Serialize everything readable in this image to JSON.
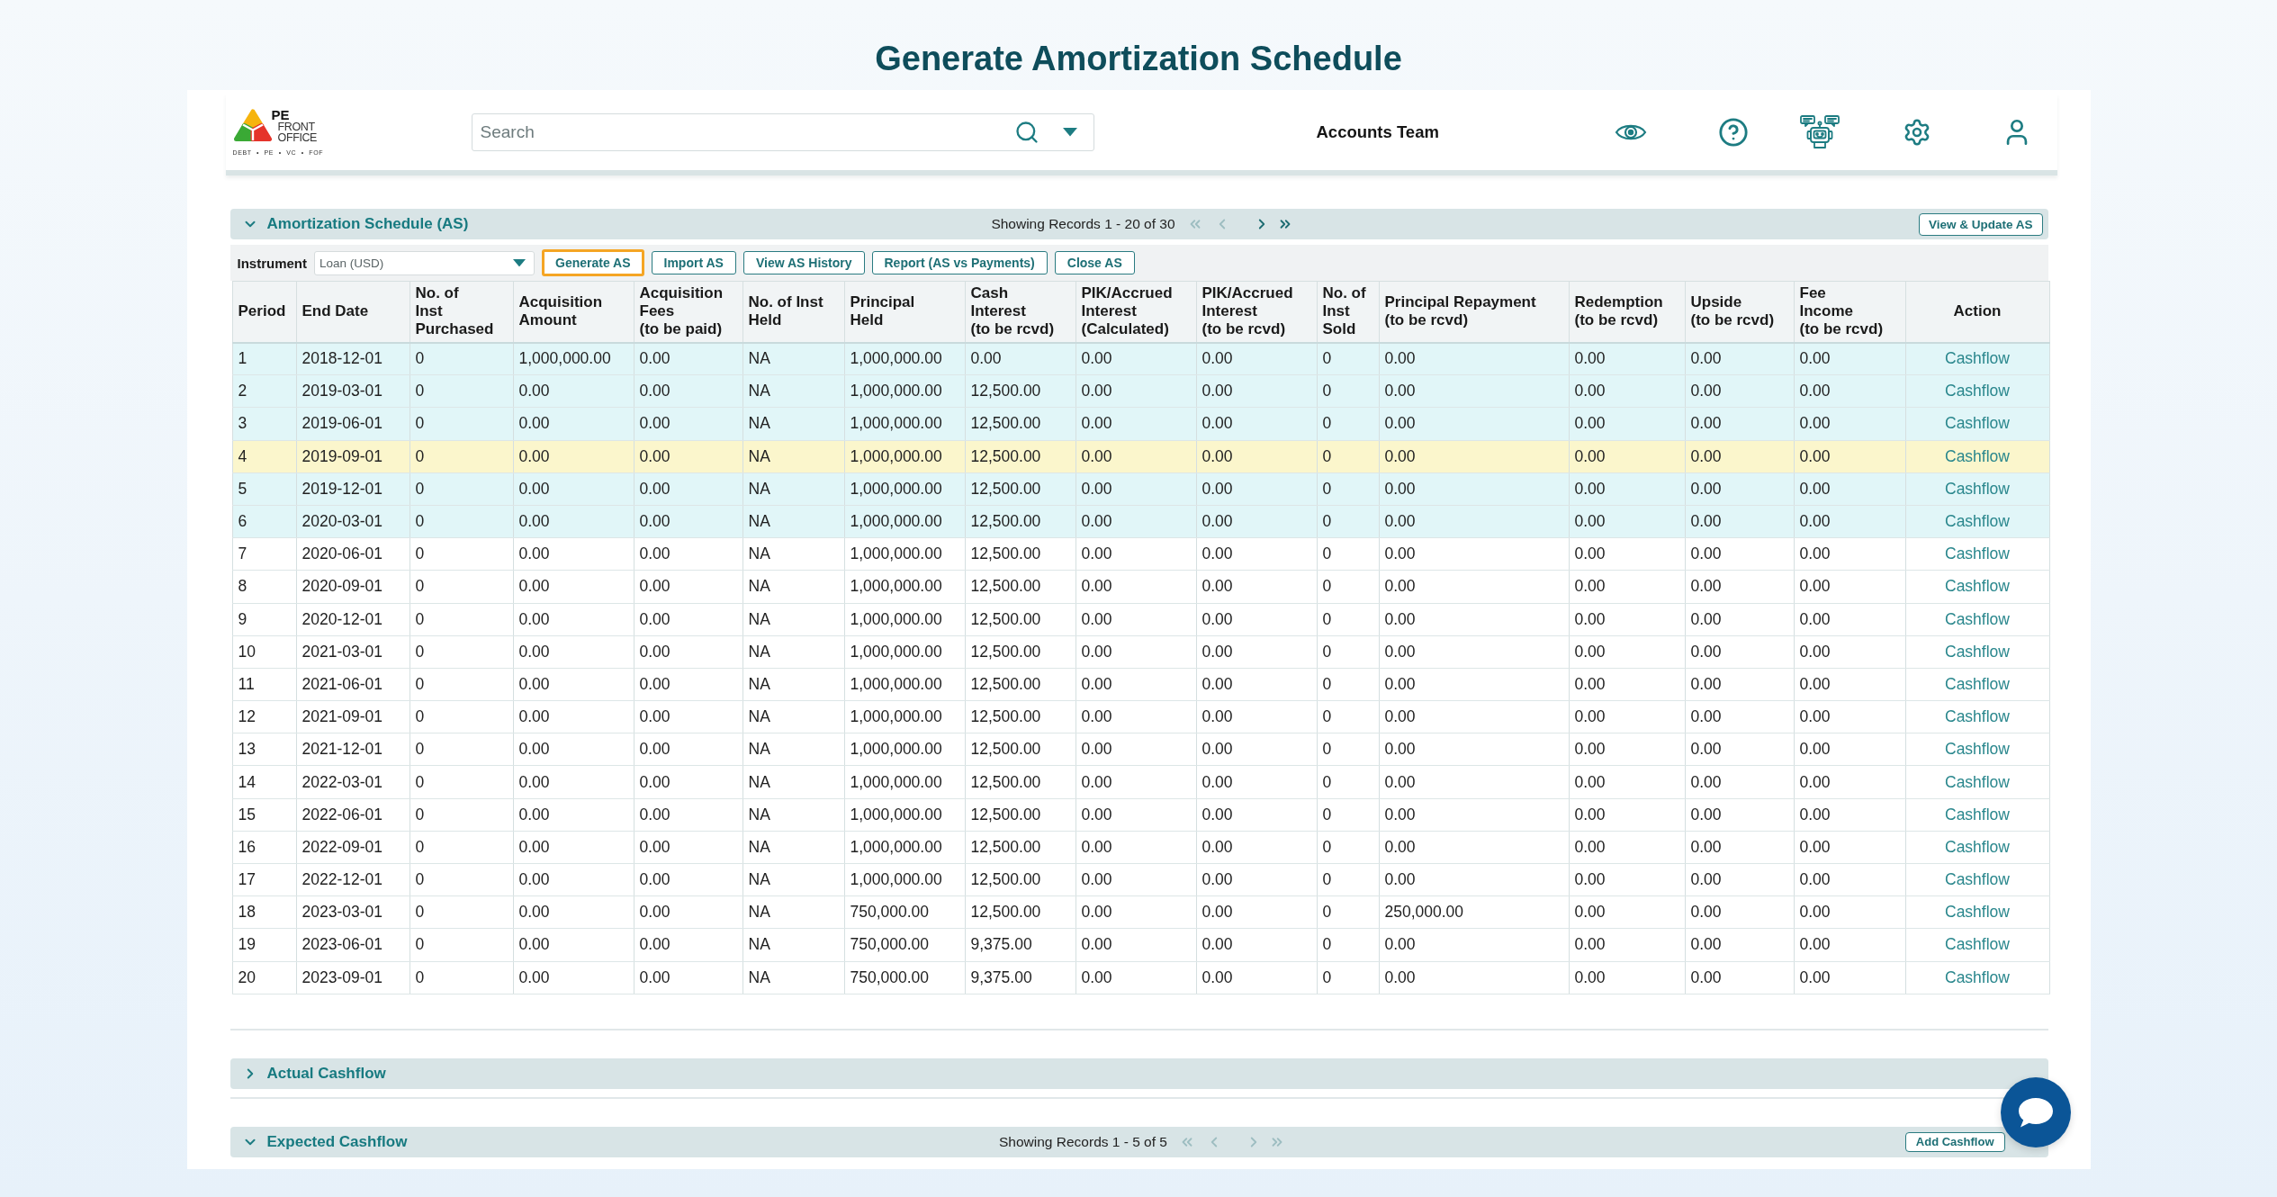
{
  "page_title": "Generate Amortization Schedule",
  "header": {
    "logo": {
      "initials": "PE",
      "name_lines": [
        "FRONT",
        "OFFICE"
      ],
      "tagline": "DEBT • PE • VC • FOF"
    },
    "search": {
      "placeholder": "Search"
    },
    "team": "Accounts Team"
  },
  "amortization_schedule": {
    "title": "Amortization Schedule (AS)",
    "expanded": true,
    "records": "Showing Records 1 - 20 of 30",
    "pager": [
      {
        "kind": "first",
        "disabled": true
      },
      {
        "kind": "previous",
        "disabled": true
      },
      {
        "kind": "next",
        "disabled": false
      },
      {
        "kind": "last",
        "disabled": false
      }
    ],
    "action_button": "View & Update AS",
    "instrument": {
      "label": "Instrument",
      "value": "Loan (USD)"
    },
    "buttons": [
      {
        "label": "Generate AS",
        "selected": true
      },
      {
        "label": "Import AS",
        "selected": false
      },
      {
        "label": "View AS History",
        "selected": false
      },
      {
        "label": "Report (AS vs Payments)",
        "selected": false
      },
      {
        "label": "Close AS",
        "selected": false
      }
    ],
    "table": {
      "columns": [
        "Period",
        "End Date",
        "No. of\nInst\nPurchased",
        "Acquisition\nAmount",
        "Acquisition\nFees\n(to be paid)",
        "No. of Inst\nHeld",
        "Principal\nHeld",
        "Cash\nInterest\n(to be rcvd)",
        "PIK/Accrued\nInterest\n(Calculated)",
        "PIK/Accrued\nInterest\n(to be rcvd)",
        "No. of\nInst\nSold",
        "Principal Repayment\n(to be rcvd)",
        "Redemption\n(to be rcvd)",
        "Upside\n(to be rcvd)",
        "Fee\nIncome\n(to be rcvd)",
        "Action"
      ],
      "rows": [
        {
          "cells": [
            "1",
            "2018-12-01",
            "0",
            "1,000,000.00",
            "0.00",
            "NA",
            "1,000,000.00",
            "0.00",
            "0.00",
            "0.00",
            "0",
            "0.00",
            "0.00",
            "0.00",
            "0.00"
          ],
          "action": "Cashflow",
          "tinted": true,
          "highlighted": false
        },
        {
          "cells": [
            "2",
            "2019-03-01",
            "0",
            "0.00",
            "0.00",
            "NA",
            "1,000,000.00",
            "12,500.00",
            "0.00",
            "0.00",
            "0",
            "0.00",
            "0.00",
            "0.00",
            "0.00"
          ],
          "action": "Cashflow",
          "tinted": true,
          "highlighted": false
        },
        {
          "cells": [
            "3",
            "2019-06-01",
            "0",
            "0.00",
            "0.00",
            "NA",
            "1,000,000.00",
            "12,500.00",
            "0.00",
            "0.00",
            "0",
            "0.00",
            "0.00",
            "0.00",
            "0.00"
          ],
          "action": "Cashflow",
          "tinted": true,
          "highlighted": false
        },
        {
          "cells": [
            "4",
            "2019-09-01",
            "0",
            "0.00",
            "0.00",
            "NA",
            "1,000,000.00",
            "12,500.00",
            "0.00",
            "0.00",
            "0",
            "0.00",
            "0.00",
            "0.00",
            "0.00"
          ],
          "action": "Cashflow",
          "tinted": false,
          "highlighted": true
        },
        {
          "cells": [
            "5",
            "2019-12-01",
            "0",
            "0.00",
            "0.00",
            "NA",
            "1,000,000.00",
            "12,500.00",
            "0.00",
            "0.00",
            "0",
            "0.00",
            "0.00",
            "0.00",
            "0.00"
          ],
          "action": "Cashflow",
          "tinted": true,
          "highlighted": false
        },
        {
          "cells": [
            "6",
            "2020-03-01",
            "0",
            "0.00",
            "0.00",
            "NA",
            "1,000,000.00",
            "12,500.00",
            "0.00",
            "0.00",
            "0",
            "0.00",
            "0.00",
            "0.00",
            "0.00"
          ],
          "action": "Cashflow",
          "tinted": true,
          "highlighted": false
        },
        {
          "cells": [
            "7",
            "2020-06-01",
            "0",
            "0.00",
            "0.00",
            "NA",
            "1,000,000.00",
            "12,500.00",
            "0.00",
            "0.00",
            "0",
            "0.00",
            "0.00",
            "0.00",
            "0.00"
          ],
          "action": "Cashflow",
          "tinted": false,
          "highlighted": false
        },
        {
          "cells": [
            "8",
            "2020-09-01",
            "0",
            "0.00",
            "0.00",
            "NA",
            "1,000,000.00",
            "12,500.00",
            "0.00",
            "0.00",
            "0",
            "0.00",
            "0.00",
            "0.00",
            "0.00"
          ],
          "action": "Cashflow",
          "tinted": false,
          "highlighted": false
        },
        {
          "cells": [
            "9",
            "2020-12-01",
            "0",
            "0.00",
            "0.00",
            "NA",
            "1,000,000.00",
            "12,500.00",
            "0.00",
            "0.00",
            "0",
            "0.00",
            "0.00",
            "0.00",
            "0.00"
          ],
          "action": "Cashflow",
          "tinted": false,
          "highlighted": false
        },
        {
          "cells": [
            "10",
            "2021-03-01",
            "0",
            "0.00",
            "0.00",
            "NA",
            "1,000,000.00",
            "12,500.00",
            "0.00",
            "0.00",
            "0",
            "0.00",
            "0.00",
            "0.00",
            "0.00"
          ],
          "action": "Cashflow",
          "tinted": false,
          "highlighted": false
        },
        {
          "cells": [
            "11",
            "2021-06-01",
            "0",
            "0.00",
            "0.00",
            "NA",
            "1,000,000.00",
            "12,500.00",
            "0.00",
            "0.00",
            "0",
            "0.00",
            "0.00",
            "0.00",
            "0.00"
          ],
          "action": "Cashflow",
          "tinted": false,
          "highlighted": false
        },
        {
          "cells": [
            "12",
            "2021-09-01",
            "0",
            "0.00",
            "0.00",
            "NA",
            "1,000,000.00",
            "12,500.00",
            "0.00",
            "0.00",
            "0",
            "0.00",
            "0.00",
            "0.00",
            "0.00"
          ],
          "action": "Cashflow",
          "tinted": false,
          "highlighted": false
        },
        {
          "cells": [
            "13",
            "2021-12-01",
            "0",
            "0.00",
            "0.00",
            "NA",
            "1,000,000.00",
            "12,500.00",
            "0.00",
            "0.00",
            "0",
            "0.00",
            "0.00",
            "0.00",
            "0.00"
          ],
          "action": "Cashflow",
          "tinted": false,
          "highlighted": false
        },
        {
          "cells": [
            "14",
            "2022-03-01",
            "0",
            "0.00",
            "0.00",
            "NA",
            "1,000,000.00",
            "12,500.00",
            "0.00",
            "0.00",
            "0",
            "0.00",
            "0.00",
            "0.00",
            "0.00"
          ],
          "action": "Cashflow",
          "tinted": false,
          "highlighted": false
        },
        {
          "cells": [
            "15",
            "2022-06-01",
            "0",
            "0.00",
            "0.00",
            "NA",
            "1,000,000.00",
            "12,500.00",
            "0.00",
            "0.00",
            "0",
            "0.00",
            "0.00",
            "0.00",
            "0.00"
          ],
          "action": "Cashflow",
          "tinted": false,
          "highlighted": false
        },
        {
          "cells": [
            "16",
            "2022-09-01",
            "0",
            "0.00",
            "0.00",
            "NA",
            "1,000,000.00",
            "12,500.00",
            "0.00",
            "0.00",
            "0",
            "0.00",
            "0.00",
            "0.00",
            "0.00"
          ],
          "action": "Cashflow",
          "tinted": false,
          "highlighted": false
        },
        {
          "cells": [
            "17",
            "2022-12-01",
            "0",
            "0.00",
            "0.00",
            "NA",
            "1,000,000.00",
            "12,500.00",
            "0.00",
            "0.00",
            "0",
            "0.00",
            "0.00",
            "0.00",
            "0.00"
          ],
          "action": "Cashflow",
          "tinted": false,
          "highlighted": false
        },
        {
          "cells": [
            "18",
            "2023-03-01",
            "0",
            "0.00",
            "0.00",
            "NA",
            "750,000.00",
            "12,500.00",
            "0.00",
            "0.00",
            "0",
            "250,000.00",
            "0.00",
            "0.00",
            "0.00"
          ],
          "action": "Cashflow",
          "tinted": false,
          "highlighted": false
        },
        {
          "cells": [
            "19",
            "2023-06-01",
            "0",
            "0.00",
            "0.00",
            "NA",
            "750,000.00",
            "9,375.00",
            "0.00",
            "0.00",
            "0",
            "0.00",
            "0.00",
            "0.00",
            "0.00"
          ],
          "action": "Cashflow",
          "tinted": false,
          "highlighted": false
        },
        {
          "cells": [
            "20",
            "2023-09-01",
            "0",
            "0.00",
            "0.00",
            "NA",
            "750,000.00",
            "9,375.00",
            "0.00",
            "0.00",
            "0",
            "0.00",
            "0.00",
            "0.00",
            "0.00"
          ],
          "action": "Cashflow",
          "tinted": false,
          "highlighted": false
        }
      ]
    }
  },
  "actual_cashflow": {
    "title": "Actual Cashflow",
    "expanded": false
  },
  "expected_cashflow": {
    "title": "Expected Cashflow",
    "expanded": true,
    "records": "Showing Records 1 - 5 of 5",
    "pager": [
      {
        "kind": "first",
        "disabled": true
      },
      {
        "kind": "previous",
        "disabled": true
      },
      {
        "kind": "next",
        "disabled": true
      },
      {
        "kind": "last",
        "disabled": true
      }
    ],
    "action_button": "Add Cashflow"
  }
}
